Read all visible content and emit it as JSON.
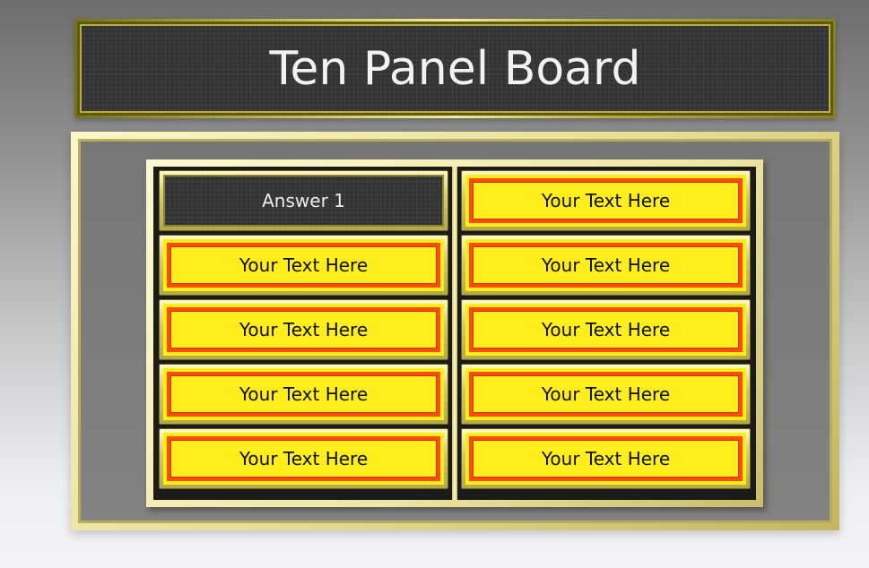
{
  "header": {
    "title": "Ten Panel Board"
  },
  "board": {
    "left_column": [
      {
        "label": "Answer  1",
        "state": "revealed"
      },
      {
        "label": "Your Text Here",
        "state": "hidden"
      },
      {
        "label": "Your Text Here",
        "state": "hidden"
      },
      {
        "label": "Your Text Here",
        "state": "hidden"
      },
      {
        "label": "Your Text Here",
        "state": "hidden"
      }
    ],
    "right_column": [
      {
        "label": "Your Text Here",
        "state": "hidden"
      },
      {
        "label": "Your Text Here",
        "state": "hidden"
      },
      {
        "label": "Your Text Here",
        "state": "hidden"
      },
      {
        "label": "Your Text Here",
        "state": "hidden"
      },
      {
        "label": "Your Text Here",
        "state": "hidden"
      }
    ]
  },
  "colors": {
    "tile_yellow": "#ffee14",
    "tile_border_orange": "#ff4c0a",
    "gold": "#e6de95",
    "revealed_bg": "#333333"
  }
}
